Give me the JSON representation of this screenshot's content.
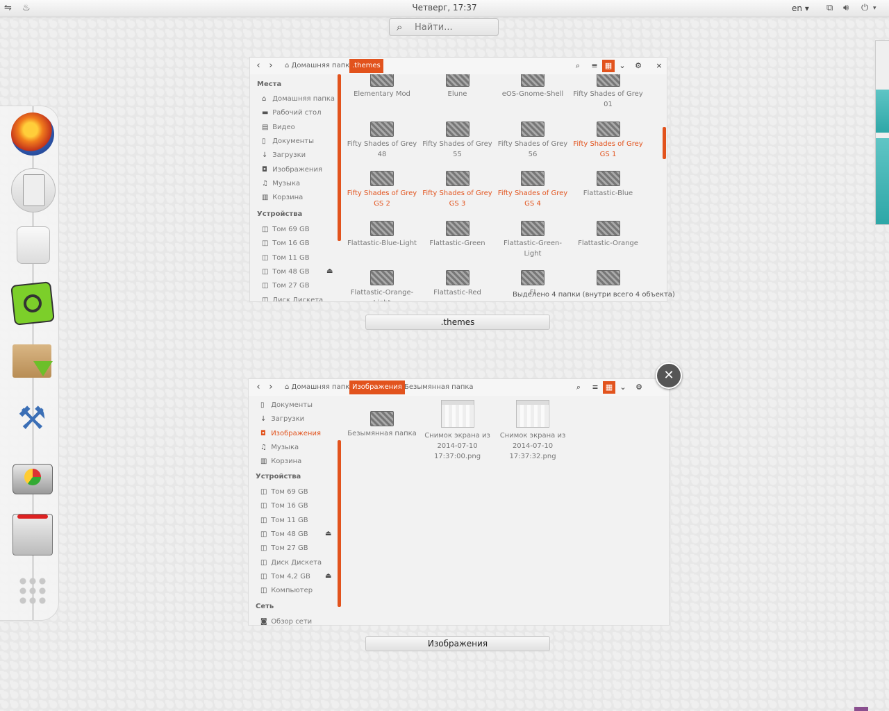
{
  "topbar": {
    "clock": "Четверг, 17:37",
    "lang": "en",
    "search_placeholder": "Найти..."
  },
  "window1": {
    "breadcrumbs": [
      "Домашняя папка",
      ".themes"
    ],
    "sidebar": {
      "places_header": "Места",
      "places": [
        {
          "label": "Домашняя папка",
          "icon": "home-icon"
        },
        {
          "label": "Рабочий стол",
          "icon": "desktop-icon"
        },
        {
          "label": "Видео",
          "icon": "video-icon"
        },
        {
          "label": "Документы",
          "icon": "document-icon"
        },
        {
          "label": "Загрузки",
          "icon": "download-icon"
        },
        {
          "label": "Изображения",
          "icon": "pictures-icon"
        },
        {
          "label": "Музыка",
          "icon": "music-icon"
        },
        {
          "label": "Корзина",
          "icon": "trash-icon"
        }
      ],
      "devices_header": "Устройства",
      "devices": [
        "Том 69 GB",
        "Том 16 GB",
        "Том 11 GB",
        "Том 48 GB",
        "Том 27 GB",
        "Диск Дискета"
      ]
    },
    "items": [
      {
        "name": "Elementary Mod",
        "hl": false
      },
      {
        "name": "Elune",
        "hl": false
      },
      {
        "name": "eOS-Gnome-Shell",
        "hl": false
      },
      {
        "name": "Fifty Shades of Grey 01",
        "hl": false
      },
      {
        "name": "Fifty Shades of Grey 48",
        "hl": false
      },
      {
        "name": "Fifty Shades of Grey 55",
        "hl": false
      },
      {
        "name": "Fifty Shades of Grey 56",
        "hl": false
      },
      {
        "name": "Fifty Shades of Grey GS 1",
        "hl": true
      },
      {
        "name": "Fifty Shades of Grey GS 2",
        "hl": true
      },
      {
        "name": "Fifty Shades of Grey GS 3",
        "hl": true
      },
      {
        "name": "Fifty Shades of Grey GS 4",
        "hl": true
      },
      {
        "name": "Flattastic-Blue",
        "hl": false
      },
      {
        "name": "Flattastic-Blue-Light",
        "hl": false
      },
      {
        "name": "Flattastic-Green",
        "hl": false
      },
      {
        "name": "Flattastic-Green-Light",
        "hl": false
      },
      {
        "name": "Flattastic-Orange",
        "hl": false
      },
      {
        "name": "Flattastic-Orange-Light",
        "hl": false
      },
      {
        "name": "Flattastic-Red",
        "hl": false
      },
      {
        "name": "Fl",
        "hl": false
      },
      {
        "name": "",
        "hl": false
      }
    ],
    "status": "Выделено 4 папки (внутри всего 4 объекта)",
    "label": ".themes"
  },
  "window2": {
    "breadcrumbs": [
      "Домашняя папка",
      "Изображения",
      "Безымянная папка"
    ],
    "sidebar": {
      "places": [
        {
          "label": "Документы",
          "icon": "document-icon",
          "sel": false
        },
        {
          "label": "Загрузки",
          "icon": "download-icon",
          "sel": false
        },
        {
          "label": "Изображения",
          "icon": "pictures-icon",
          "sel": true
        },
        {
          "label": "Музыка",
          "icon": "music-icon",
          "sel": false
        },
        {
          "label": "Корзина",
          "icon": "trash-icon",
          "sel": false
        }
      ],
      "devices_header": "Устройства",
      "devices": [
        "Том 69 GB",
        "Том 16 GB",
        "Том 11 GB",
        "Том 48 GB",
        "Том 27 GB",
        "Диск Дискета",
        "Том 4,2 GB",
        "Компьютер"
      ],
      "network_header": "Сеть",
      "network": [
        "Обзор сети"
      ]
    },
    "items": [
      {
        "name": "Безымянная папка",
        "kind": "folder"
      },
      {
        "name": "Снимок экрана из 2014-07-10 17:37:00.png",
        "kind": "image"
      },
      {
        "name": "Снимок экрана из 2014-07-10 17:37:32.png",
        "kind": "image"
      }
    ],
    "label": "Изображения"
  },
  "colors": {
    "accent": "#e2531d"
  }
}
